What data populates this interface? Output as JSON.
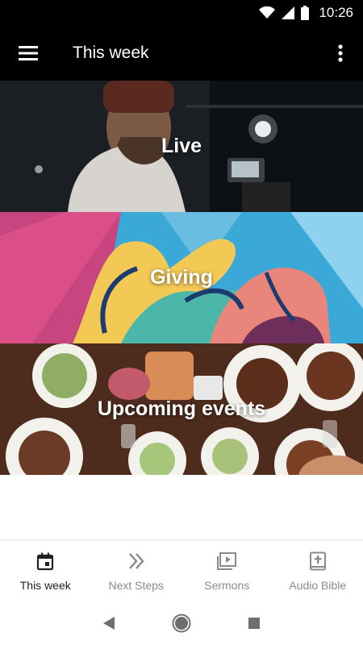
{
  "status_bar": {
    "time": "10:26"
  },
  "app_bar": {
    "title": "This week"
  },
  "tiles": [
    {
      "label": "Live"
    },
    {
      "label": "Giving"
    },
    {
      "label": "Upcoming events"
    }
  ],
  "bottom_nav": {
    "items": [
      {
        "label": "This week",
        "icon": "calendar-icon",
        "active": true
      },
      {
        "label": "Next Steps",
        "icon": "double-chevron-icon",
        "active": false
      },
      {
        "label": "Sermons",
        "icon": "video-library-icon",
        "active": false
      },
      {
        "label": "Audio Bible",
        "icon": "bible-icon",
        "active": false
      }
    ]
  },
  "colors": {
    "app_bar": "#000000",
    "active_nav": "#222222",
    "inactive_nav": "#8a8a8a"
  }
}
